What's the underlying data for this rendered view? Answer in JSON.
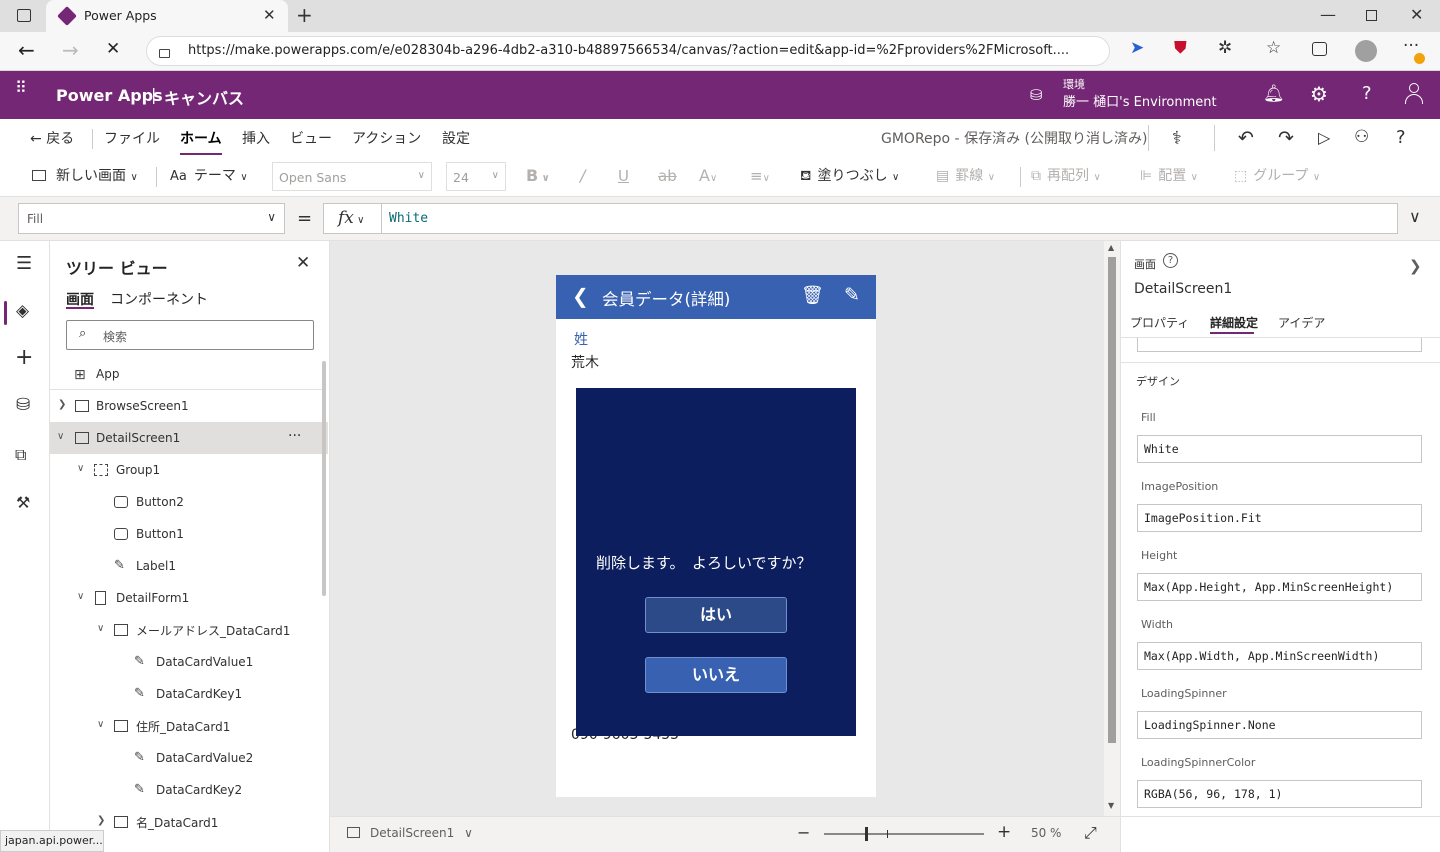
{
  "browser": {
    "tab_title": "Power Apps",
    "url": "https://make.powerapps.com/e/e028304b-a296-4db2-a310-b48897566534/canvas/?action=edit&app-id=%2Fproviders%2FMicrosoft....",
    "status_url": "japan.api.power..."
  },
  "header": {
    "app_name": "Power Apps",
    "section": "キャンバス",
    "env_label": "環境",
    "env_name": "勝一 樋口's Environment"
  },
  "menu": {
    "back": "戻る",
    "items": [
      "ファイル",
      "ホーム",
      "挿入",
      "ビュー",
      "アクション",
      "設定"
    ],
    "active": "ホーム",
    "save_status": "GMORepo - 保存済み (公開取り消し済み)"
  },
  "toolbar": {
    "new_screen": "新しい画面",
    "theme": "テーマ",
    "font": "Open Sans",
    "font_size": "24",
    "fill": "塗りつぶし",
    "border": "罫線",
    "reorder": "再配列",
    "align": "配置",
    "group": "グループ"
  },
  "formula": {
    "property": "Fill",
    "equals": "=",
    "fx": "fx",
    "value": "White"
  },
  "tree": {
    "title": "ツリー ビュー",
    "tab_screens": "画面",
    "tab_components": "コンポーネント",
    "search_placeholder": "検索",
    "items": [
      {
        "label": "App"
      },
      {
        "label": "BrowseScreen1"
      },
      {
        "label": "DetailScreen1"
      },
      {
        "label": "Group1"
      },
      {
        "label": "Button2"
      },
      {
        "label": "Button1"
      },
      {
        "label": "Label1"
      },
      {
        "label": "DetailForm1"
      },
      {
        "label": "メールアドレス_DataCard1"
      },
      {
        "label": "DataCardValue1"
      },
      {
        "label": "DataCardKey1"
      },
      {
        "label": "住所_DataCard1"
      },
      {
        "label": "DataCardValue2"
      },
      {
        "label": "DataCardKey2"
      },
      {
        "label": "名_DataCard1"
      }
    ],
    "more": "···"
  },
  "app_screen": {
    "title": "会員データ(詳細)",
    "field1_label": "姓",
    "field1_value": "荒木",
    "phone_partial": "090-9603-5455",
    "dialog_message": "削除します。　よろしいですか？",
    "yes": "はい",
    "no": "いいえ",
    "colors": {
      "header": "#3861b2",
      "dialog": "#0c1e5e",
      "button": "#3861b2"
    }
  },
  "canvas_footer": {
    "screen": "DetailScreen1",
    "zoom": "50",
    "percent": "%"
  },
  "props": {
    "kind": "画面",
    "name": "DetailScreen1",
    "tabs": [
      "プロパティ",
      "詳細設定",
      "アイデア"
    ],
    "active_tab": "詳細設定",
    "section": "デザイン",
    "fields": [
      {
        "label": "Fill",
        "value": "White"
      },
      {
        "label": "ImagePosition",
        "value": "ImagePosition.Fit"
      },
      {
        "label": "Height",
        "value": "Max(App.Height, App.MinScreenHeight)"
      },
      {
        "label": "Width",
        "value": "Max(App.Width, App.MinScreenWidth)"
      },
      {
        "label": "LoadingSpinner",
        "value": "LoadingSpinner.None"
      },
      {
        "label": "LoadingSpinnerColor",
        "value": "RGBA(56, 96, 178, 1)"
      }
    ]
  }
}
